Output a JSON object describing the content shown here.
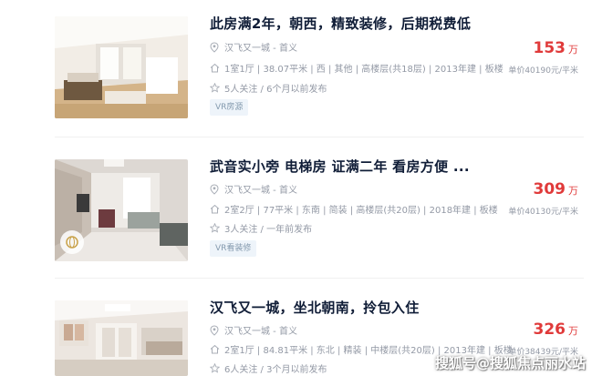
{
  "listings": [
    {
      "title": "此房满2年，朝西，精致装修，后期税费低",
      "location": "汉飞又一城 - 首义",
      "details": "1室1厅 | 38.07平米 | 西 | 其他 | 高楼层(共18层) | 2013年建 | 板楼",
      "followers": "5人关注 / 6个月以前发布",
      "tag": "VR房源",
      "price": "153",
      "price_unit": "万",
      "unit_price": "单价40190元/平米"
    },
    {
      "title": "武音实小旁 电梯房 证满二年 看房方便 ...",
      "location": "汉飞又一城 - 首义",
      "details": "2室2厅 | 77平米 | 东南 | 简装 | 高楼层(共20层) | 2018年建 | 板楼",
      "followers": "3人关注 / 一年前发布",
      "tag": "VR看装修",
      "price": "309",
      "price_unit": "万",
      "unit_price": "单价40130元/平米"
    },
    {
      "title": "汉飞又一城，坐北朝南，拎包入住",
      "location": "汉飞又一城 - 首义",
      "details": "2室1厅 | 84.81平米 | 东北 | 精装 | 中楼层(共20层) | 2013年建 | 板楼",
      "followers": "6人关注 / 3个月以前发布",
      "tag": "",
      "price": "326",
      "price_unit": "万",
      "unit_price": "单价38439元/平米"
    }
  ],
  "watermark": "搜狐号@搜狐焦点丽水站",
  "colors": {
    "price": "#e03a3a",
    "title": "#101d37",
    "meta": "#9399a5",
    "tag_bg": "#eef4fa",
    "tag_text": "#849aae"
  }
}
